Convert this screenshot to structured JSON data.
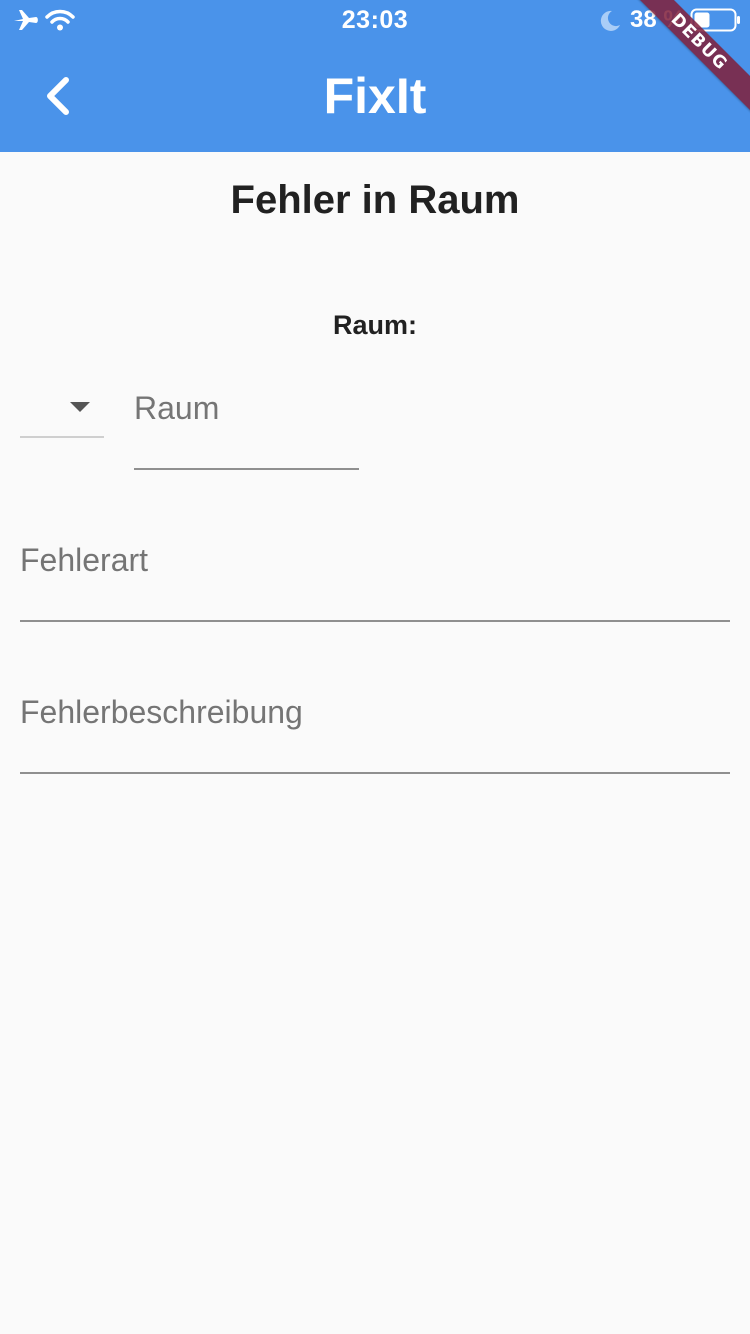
{
  "status_bar": {
    "time": "23:03",
    "battery_percent": "38 %",
    "icons": [
      "airplane-icon",
      "wifi-icon",
      "moon-icon",
      "battery-icon"
    ]
  },
  "app_bar": {
    "title": "FixIt",
    "back_icon": "chevron-left-icon",
    "color": "#4a93ea"
  },
  "debug_banner": "DEBUG",
  "page": {
    "title": "Fehler in Raum",
    "room_label": "Raum:",
    "room_dropdown_icon": "dropdown-arrow-icon",
    "room_field_placeholder": "Raum",
    "fehlerart_placeholder": "Fehlerart",
    "beschreibung_placeholder": "Fehlerbeschreibung"
  }
}
